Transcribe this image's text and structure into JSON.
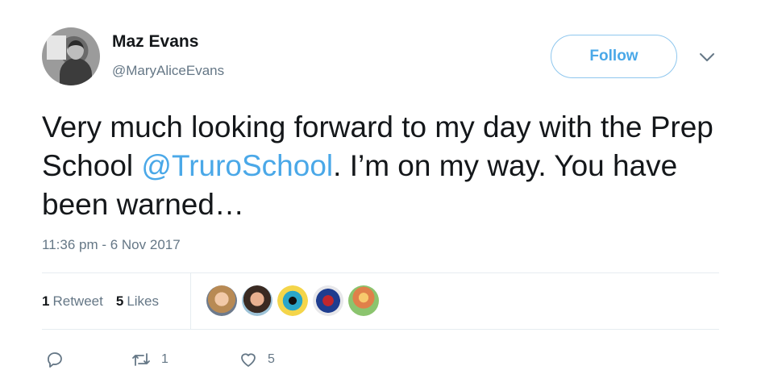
{
  "author": {
    "name": "Maz Evans",
    "handle": "@MaryAliceEvans"
  },
  "follow_label": "Follow",
  "tweet": {
    "text_before": "Very much looking forward to my day with the Prep School ",
    "mention": "@TruroSchool",
    "text_after": ". I’m on my way. You have been warned…"
  },
  "timestamp": "11:36 pm - 6 Nov 2017",
  "stats": {
    "retweets_count": "1",
    "retweets_label": "Retweet",
    "likes_count": "5",
    "likes_label": "Likes"
  },
  "actions": {
    "reply_count": "",
    "retweet_count": "1",
    "like_count": "5"
  },
  "colors": {
    "accent": "#4aa8e8",
    "muted": "#657786",
    "text": "#14171a"
  },
  "icons": [
    "caret-down-icon",
    "reply-icon",
    "retweet-icon",
    "heart-icon"
  ]
}
